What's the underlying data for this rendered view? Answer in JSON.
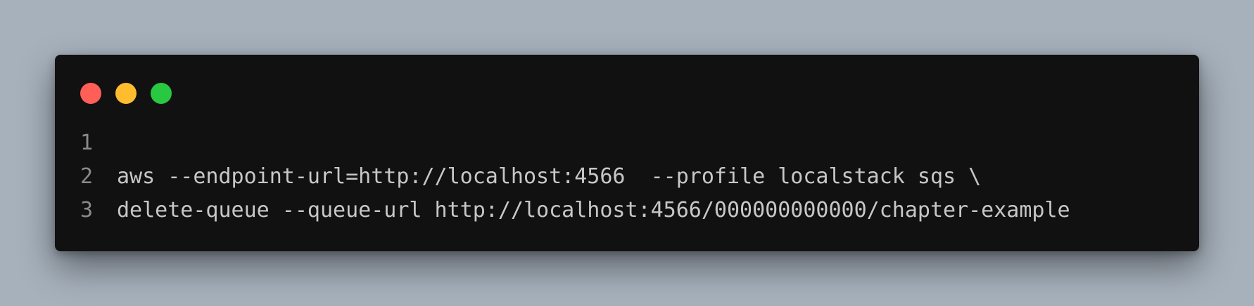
{
  "window": {
    "traffic_lights": [
      {
        "name": "close",
        "color": "#ff5f57"
      },
      {
        "name": "minimize",
        "color": "#febc2e"
      },
      {
        "name": "maximize",
        "color": "#28c840"
      }
    ]
  },
  "code": {
    "lines": [
      {
        "number": "1",
        "text": ""
      },
      {
        "number": "2",
        "text": "aws --endpoint-url=http://localhost:4566  --profile localstack sqs \\"
      },
      {
        "number": "3",
        "text": "delete-queue --queue-url http://localhost:4566/000000000000/chapter-example"
      }
    ]
  }
}
